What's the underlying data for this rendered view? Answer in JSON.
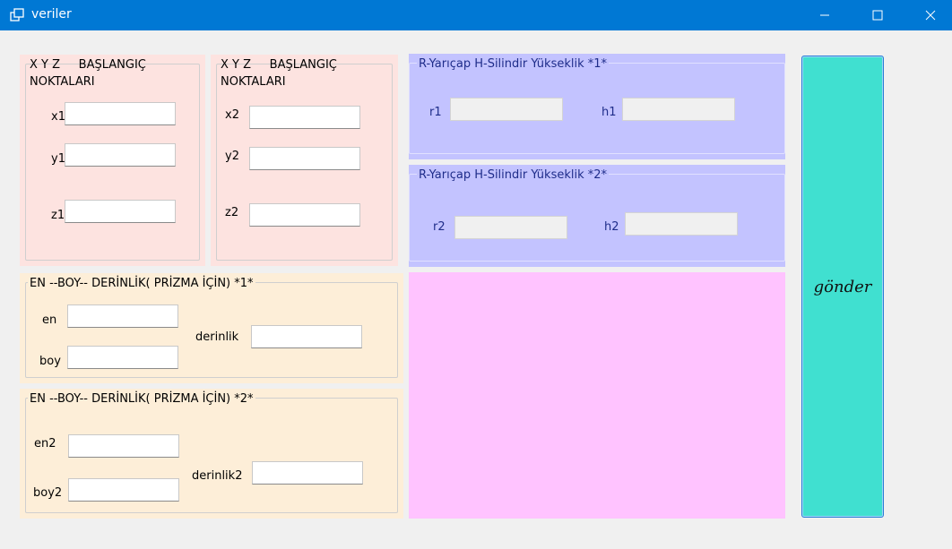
{
  "window": {
    "title": "veriler",
    "icons": [
      "app-icon",
      "minimize-icon",
      "maximize-icon",
      "close-icon"
    ]
  },
  "xyz1": {
    "title": "X Y Z     BAŞLANGIÇ\nNOKTALARI",
    "x_label": "x1",
    "y_label": "y1",
    "z_label": "z1"
  },
  "xyz2": {
    "title": "X Y Z     BAŞLANGIÇ\nNOKTALARI",
    "x_label": "x2",
    "y_label": "y2",
    "z_label": "z2"
  },
  "prism1": {
    "title": "EN --BOY-- DERİNLİK( PRİZMA İÇİN) *1*",
    "en_label": "en",
    "boy_label": "boy",
    "derinlik_label": "derinlik"
  },
  "prism2": {
    "title": "EN --BOY-- DERİNLİK( PRİZMA İÇİN)  *2*",
    "en_label": "en2",
    "boy_label": "boy2",
    "derinlik_label": "derinlik2"
  },
  "cyl1": {
    "title": "R-Yarıçap   H-Silindir Yükseklik  *1*",
    "r_label": "r1",
    "h_label": "h1"
  },
  "cyl2": {
    "title": "R-Yarıçap   H-Silindir Yükseklik *2*",
    "r_label": "r2",
    "h_label": "h2"
  },
  "send_button": {
    "label": "gönder"
  },
  "colors": {
    "titlebar": "#0078d4",
    "pink": "#fde3e0",
    "beige": "#fdeed8",
    "blue": "#c3c3ff",
    "magenta": "#ffc3ff",
    "turquoise": "#40e0d0"
  }
}
